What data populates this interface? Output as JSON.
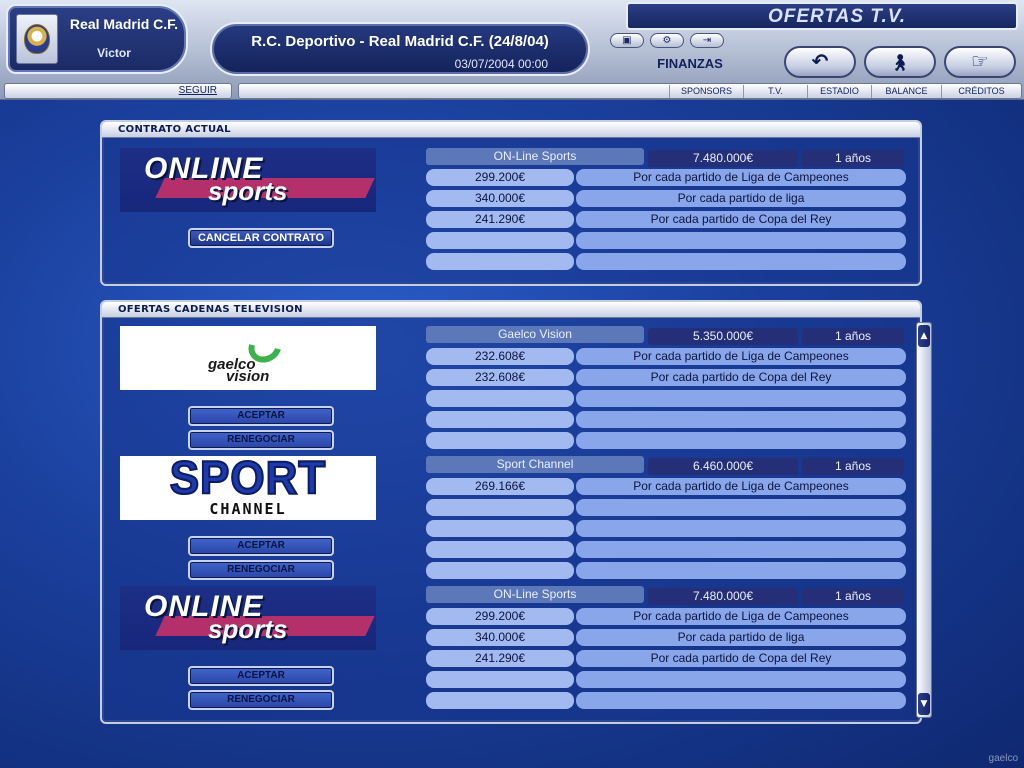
{
  "header": {
    "club_name": "Real Madrid C.F.",
    "manager_name": "Victor",
    "match_title": "R.C. Deportivo - Real Madrid C.F. (24/8/04)",
    "match_date": "03/07/2004 00:00",
    "screen_title": "OFERTAS T.V.",
    "section": "FINANZAS",
    "seguir": "SEGUIR",
    "tabs": [
      "SPONSORS",
      "T.V.",
      "ESTADIO",
      "BALANCE",
      "CRÉDITOS"
    ],
    "mini_icons": [
      "save-icon",
      "options-icon",
      "exit-icon"
    ],
    "nav_icons": [
      "back-arrow-icon",
      "walk-icon",
      "pointing-hand-icon"
    ]
  },
  "current_contract": {
    "title": "CONTRATO ACTUAL",
    "logo": {
      "line1": "ONLINE",
      "line2": "sports"
    },
    "cancel_label": "CANCELAR CONTRATO",
    "offer": {
      "name": "ON-Line Sports",
      "total": "7.480.000€",
      "years": "1 años",
      "rows": [
        {
          "amount": "299.200€",
          "desc": "Por cada partido de Liga de Campeones"
        },
        {
          "amount": "340.000€",
          "desc": "Por cada partido de liga"
        },
        {
          "amount": "241.290€",
          "desc": "Por cada partido de Copa del Rey"
        },
        {
          "amount": "",
          "desc": ""
        },
        {
          "amount": "",
          "desc": ""
        }
      ]
    }
  },
  "offers": {
    "title": "OFERTAS CADENAS TELEVISION",
    "accept_label": "ACEPTAR",
    "renegotiate_label": "RENEGOCIAR",
    "items": [
      {
        "logo": {
          "line1": "gaelco",
          "line2": "vision"
        },
        "name": "Gaelco Vision",
        "total": "5.350.000€",
        "years": "1 años",
        "rows": [
          {
            "amount": "232.608€",
            "desc": "Por cada partido de Liga de Campeones"
          },
          {
            "amount": "232.608€",
            "desc": "Por cada partido de Copa del Rey"
          },
          {
            "amount": "",
            "desc": ""
          },
          {
            "amount": "",
            "desc": ""
          },
          {
            "amount": "",
            "desc": ""
          }
        ]
      },
      {
        "logo": {
          "line1": "SPORT",
          "line2": "CHANNEL"
        },
        "name": "Sport Channel",
        "total": "6.460.000€",
        "years": "1 años",
        "rows": [
          {
            "amount": "269.166€",
            "desc": "Por cada partido de Liga de Campeones"
          },
          {
            "amount": "",
            "desc": ""
          },
          {
            "amount": "",
            "desc": ""
          },
          {
            "amount": "",
            "desc": ""
          },
          {
            "amount": "",
            "desc": ""
          }
        ]
      },
      {
        "logo": {
          "line1": "ONLINE",
          "line2": "sports"
        },
        "name": "ON-Line Sports",
        "total": "7.480.000€",
        "years": "1 años",
        "rows": [
          {
            "amount": "299.200€",
            "desc": "Por cada partido de Liga de Campeones"
          },
          {
            "amount": "340.000€",
            "desc": "Por cada partido de liga"
          },
          {
            "amount": "241.290€",
            "desc": "Por cada partido de Copa del Rey"
          },
          {
            "amount": "",
            "desc": ""
          },
          {
            "amount": "",
            "desc": ""
          }
        ]
      }
    ]
  },
  "watermark": "gaelco",
  "colors": {
    "accent": "#1a3f9c",
    "field_light": "#a3baf0",
    "field_dark": "#252f78"
  }
}
